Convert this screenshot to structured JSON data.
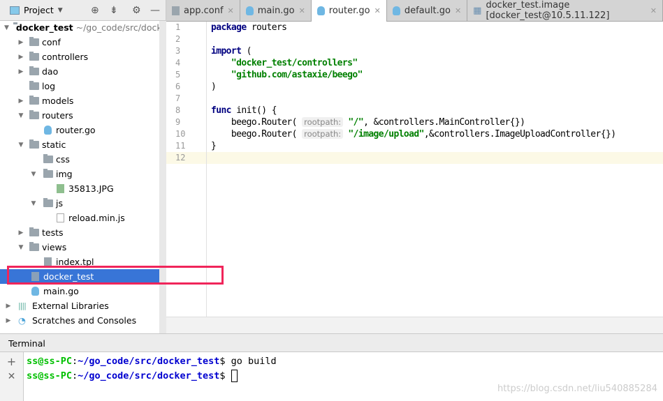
{
  "sidebar": {
    "title": "Project",
    "root": {
      "name": "docker_test",
      "path": "~/go_code/src/docker"
    },
    "items": [
      "conf",
      "controllers",
      "dao",
      "log",
      "models",
      "routers",
      "router.go",
      "static",
      "css",
      "img",
      "35813.JPG",
      "js",
      "reload.min.js",
      "tests",
      "views",
      "index.tpl",
      "docker_test",
      "main.go",
      "External Libraries",
      "Scratches and Consoles"
    ]
  },
  "tabs": [
    {
      "label": "app.conf"
    },
    {
      "label": "main.go"
    },
    {
      "label": "router.go"
    },
    {
      "label": "default.go"
    },
    {
      "label": "docker_test.image [docker_test@10.5.11.122]"
    }
  ],
  "editor": {
    "line_numbers": [
      "1",
      "2",
      "3",
      "4",
      "5",
      "6",
      "7",
      "8",
      "9",
      "10",
      "11",
      "12"
    ],
    "kw_package": "package",
    "pkg": " routers",
    "kw_import": "import",
    " paren": " (",
    "imp1": "\"docker_test/controllers\"",
    "imp2": "\"github.com/astaxie/beego\"",
    "close": ")",
    "kw_func": "func",
    " init": " init() {",
    "call": "beego.Router(",
    "hint": "rootpath:",
    "s1": "\"/\"",
    "r1": ", &controllers.MainController{})",
    "s2": "\"/image/upload\"",
    "r2": ",&controllers.ImageUploadController{})",
    "brace": "}"
  },
  "terminal": {
    "title": "Terminal",
    "user": "ss@ss-PC",
    "path": "~/go_code/src/docker_test",
    "colon": ":",
    "prompt": "$ ",
    "cmd1": "go build",
    "add": "+",
    "close": "✕"
  },
  "watermark": "https://blog.csdn.net/liu540885284"
}
